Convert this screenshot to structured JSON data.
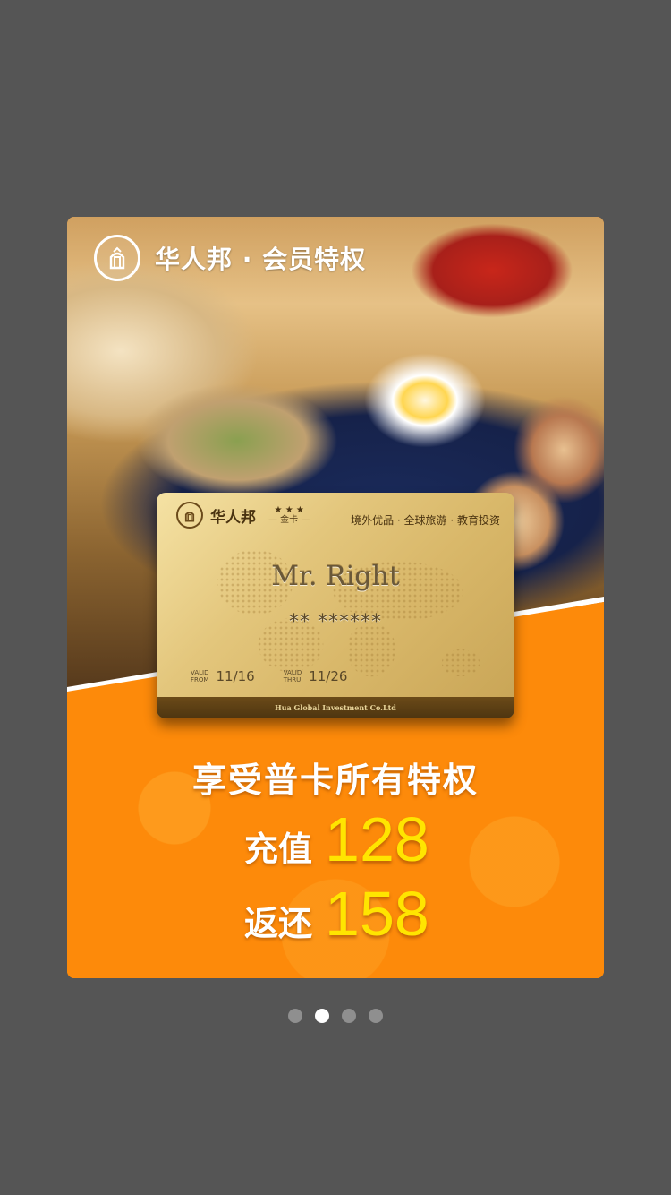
{
  "promo": {
    "brand_title": "华人邦 · 会员特权",
    "card": {
      "brand": "华人邦",
      "grade_stars": "★ ★ ★",
      "grade": "— 金卡 —",
      "tagline": "境外优品 · 全球旅游 · 教育投资",
      "holder": "Mr. Right",
      "number": "** ******",
      "valid_from_label_1": "VALID",
      "valid_from_label_2": "FROM",
      "valid_from": "11/16",
      "valid_thru_label_1": "VALID",
      "valid_thru_label_2": "THRU",
      "valid_thru": "11/26",
      "issuer": "Hua Global Investment Co.Ltd"
    },
    "headline": "享受普卡所有特权",
    "recharge_label": "充值",
    "recharge_amount": "128",
    "return_label": "返还",
    "return_amount": "158"
  },
  "pager": {
    "count": 4,
    "active_index": 1
  },
  "colors": {
    "accent": "#fd8a0a",
    "highlight": "#ffe500",
    "backdrop": "#555555"
  }
}
